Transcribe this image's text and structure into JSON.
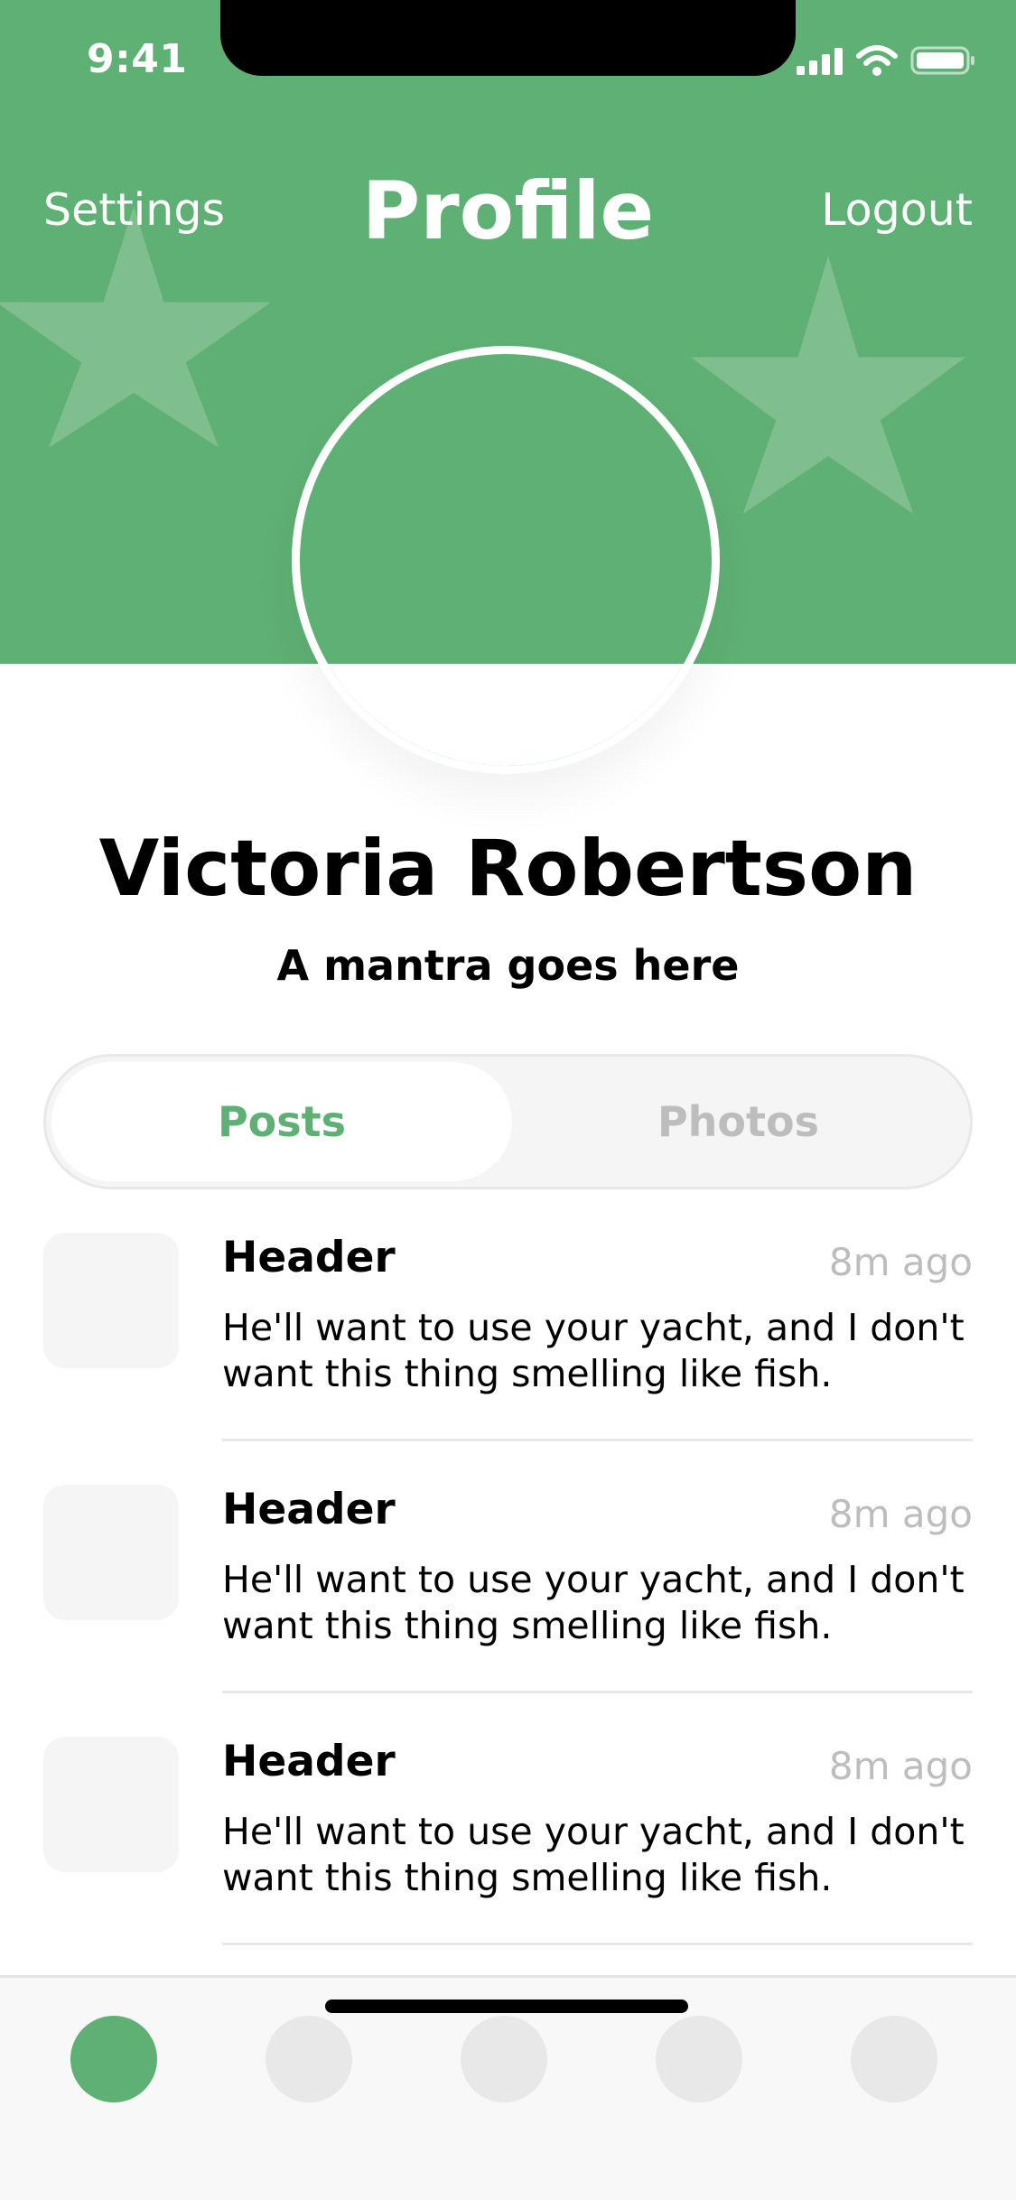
{
  "status_bar": {
    "time": "9:41"
  },
  "header": {
    "title": "Profile",
    "left_action": "Settings",
    "right_action": "Logout"
  },
  "profile": {
    "name": "Victoria Robertson",
    "mantra": "A mantra goes here"
  },
  "segments": {
    "active": "Posts",
    "items": [
      {
        "label": "Posts"
      },
      {
        "label": "Photos"
      }
    ]
  },
  "feed": {
    "items": [
      {
        "header": "Header",
        "time": "8m ago",
        "body": "He'll want to use your yacht, and I don't want this thing smelling like fish."
      },
      {
        "header": "Header",
        "time": "8m ago",
        "body": "He'll want to use your yacht, and I don't want this thing smelling like fish."
      },
      {
        "header": "Header",
        "time": "8m ago",
        "body": "He'll want to use your yacht, and I don't want this thing smelling like fish."
      }
    ]
  },
  "tab_bar": {
    "count": 5,
    "active_index": 0
  },
  "colors": {
    "accent": "#5fb074",
    "inactive": "#e8e8e8",
    "muted_text": "#bdbdbd"
  }
}
